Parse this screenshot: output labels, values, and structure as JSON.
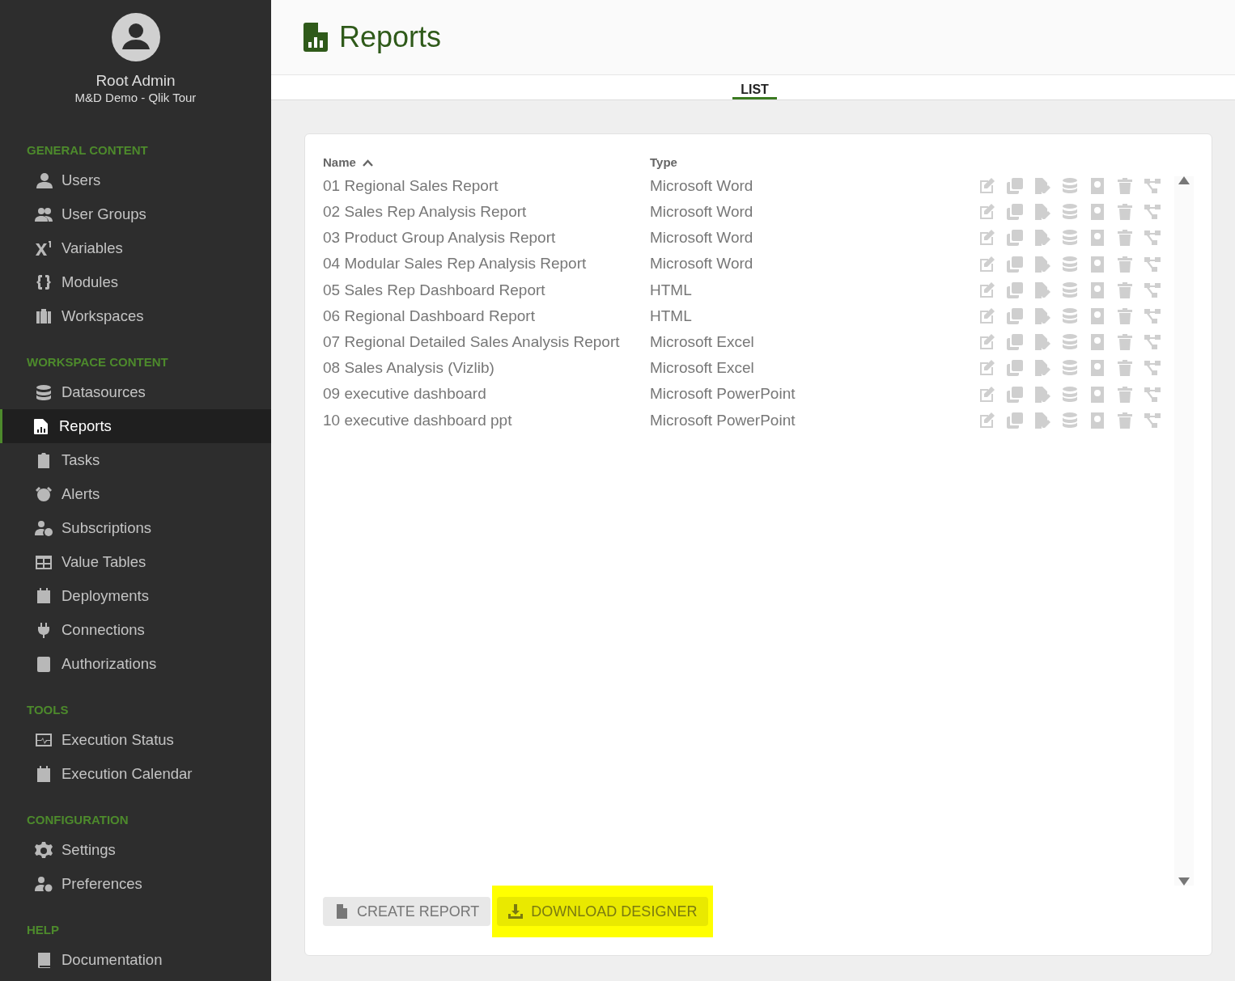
{
  "user": {
    "name": "Root Admin",
    "subtitle": "M&D Demo - Qlik Tour"
  },
  "sidebar": {
    "sections": [
      {
        "title": "GENERAL CONTENT",
        "items": [
          {
            "label": "Users",
            "selected": false
          },
          {
            "label": "User Groups",
            "selected": false
          },
          {
            "label": "Variables",
            "selected": false
          },
          {
            "label": "Modules",
            "selected": false
          },
          {
            "label": "Workspaces",
            "selected": false
          }
        ]
      },
      {
        "title": "WORKSPACE CONTENT",
        "items": [
          {
            "label": "Datasources",
            "selected": false
          },
          {
            "label": "Reports",
            "selected": true
          },
          {
            "label": "Tasks",
            "selected": false
          },
          {
            "label": "Alerts",
            "selected": false
          },
          {
            "label": "Subscriptions",
            "selected": false
          },
          {
            "label": "Value Tables",
            "selected": false
          },
          {
            "label": "Deployments",
            "selected": false
          },
          {
            "label": "Connections",
            "selected": false
          },
          {
            "label": "Authorizations",
            "selected": false
          }
        ]
      },
      {
        "title": "TOOLS",
        "items": [
          {
            "label": "Execution Status",
            "selected": false
          },
          {
            "label": "Execution Calendar",
            "selected": false
          }
        ]
      },
      {
        "title": "CONFIGURATION",
        "items": [
          {
            "label": "Settings",
            "selected": false
          },
          {
            "label": "Preferences",
            "selected": false
          }
        ]
      },
      {
        "title": "HELP",
        "items": [
          {
            "label": "Documentation",
            "selected": false
          }
        ]
      }
    ]
  },
  "page": {
    "title": "Reports"
  },
  "tabs": [
    {
      "label": "LIST",
      "selected": true
    }
  ],
  "table": {
    "columns": [
      "Name",
      "Type"
    ],
    "rows": [
      {
        "name": "01 Regional Sales Report",
        "type": "Microsoft Word"
      },
      {
        "name": "02 Sales Rep Analysis Report",
        "type": "Microsoft Word"
      },
      {
        "name": "03 Product Group Analysis Report",
        "type": "Microsoft Word"
      },
      {
        "name": "04 Modular Sales Rep Analysis Report",
        "type": "Microsoft Word"
      },
      {
        "name": "05 Sales Rep Dashboard Report",
        "type": "HTML"
      },
      {
        "name": "06 Regional Dashboard Report",
        "type": "HTML"
      },
      {
        "name": "07 Regional Detailed Sales Analysis Report",
        "type": "Microsoft Excel"
      },
      {
        "name": "08 Sales Analysis (Vizlib)",
        "type": "Microsoft Excel"
      },
      {
        "name": "09 executive dashboard",
        "type": "Microsoft PowerPoint"
      },
      {
        "name": "10 executive dashboard ppt",
        "type": "Microsoft PowerPoint"
      }
    ]
  },
  "buttons": [
    {
      "label": "CREATE REPORT",
      "highlighted": false
    },
    {
      "label": "DOWNLOAD DESIGNER",
      "highlighted": true
    }
  ]
}
